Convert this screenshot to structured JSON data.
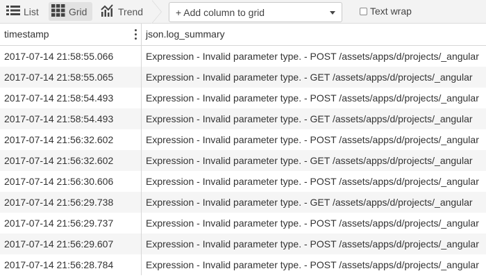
{
  "toolbar": {
    "views": [
      {
        "label": "List",
        "icon": "list-icon",
        "active": false
      },
      {
        "label": "Grid",
        "icon": "grid-icon",
        "active": true
      },
      {
        "label": "Trend",
        "icon": "trend-icon",
        "active": false
      }
    ],
    "add_column_label": "+ Add column to grid",
    "text_wrap_label": "Text wrap",
    "text_wrap_checked": false
  },
  "grid": {
    "columns": [
      "timestamp",
      "json.log_summary"
    ],
    "rows": [
      {
        "timestamp": "2017-07-14 21:58:55.066",
        "log_summary": "Expression - Invalid parameter type. - POST /assets/apps/d/projects/_angular"
      },
      {
        "timestamp": "2017-07-14 21:58:55.065",
        "log_summary": "Expression - Invalid parameter type. - GET /assets/apps/d/projects/_angular"
      },
      {
        "timestamp": "2017-07-14 21:58:54.493",
        "log_summary": "Expression - Invalid parameter type. - POST /assets/apps/d/projects/_angular"
      },
      {
        "timestamp": "2017-07-14 21:58:54.493",
        "log_summary": "Expression - Invalid parameter type. - GET /assets/apps/d/projects/_angular"
      },
      {
        "timestamp": "2017-07-14 21:56:32.602",
        "log_summary": "Expression - Invalid parameter type. - POST /assets/apps/d/projects/_angular"
      },
      {
        "timestamp": "2017-07-14 21:56:32.602",
        "log_summary": "Expression - Invalid parameter type. - GET /assets/apps/d/projects/_angular"
      },
      {
        "timestamp": "2017-07-14 21:56:30.606",
        "log_summary": "Expression - Invalid parameter type. - POST /assets/apps/d/projects/_angular"
      },
      {
        "timestamp": "2017-07-14 21:56:29.738",
        "log_summary": "Expression - Invalid parameter type. - GET /assets/apps/d/projects/_angular"
      },
      {
        "timestamp": "2017-07-14 21:56:29.737",
        "log_summary": "Expression - Invalid parameter type. - POST /assets/apps/d/projects/_angular"
      },
      {
        "timestamp": "2017-07-14 21:56:29.607",
        "log_summary": "Expression - Invalid parameter type. - POST /assets/apps/d/projects/_angular"
      },
      {
        "timestamp": "2017-07-14 21:56:28.784",
        "log_summary": "Expression - Invalid parameter type. - POST /assets/apps/d/projects/_angular"
      }
    ]
  }
}
